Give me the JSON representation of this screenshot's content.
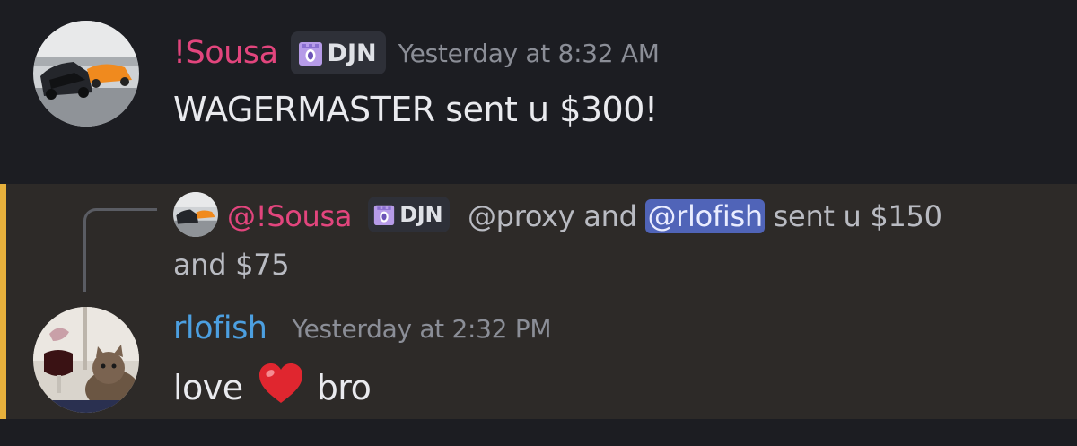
{
  "messages": [
    {
      "author": "!Sousa",
      "tag": "DJN",
      "timestamp": "Yesterday at 8:32 AM",
      "content": "WAGERMASTER sent u $300!",
      "avatar_icon": "cars-avatar",
      "author_color": "#e2457d"
    },
    {
      "reply": {
        "author": "@!Sousa",
        "tag": "DJN",
        "text_before": "@proxy and ",
        "mention": "@rlofish",
        "text_line1_after": " sent u $150",
        "text_line2": "and $75"
      },
      "author": "rlofish",
      "timestamp": "Yesterday at 2:32 PM",
      "content_before": "love",
      "emoji": "red-heart",
      "content_after": "bro",
      "avatar_icon": "cat-avatar",
      "author_color": "#4c9fe0",
      "highlight_color": "#e6b03c"
    }
  ]
}
